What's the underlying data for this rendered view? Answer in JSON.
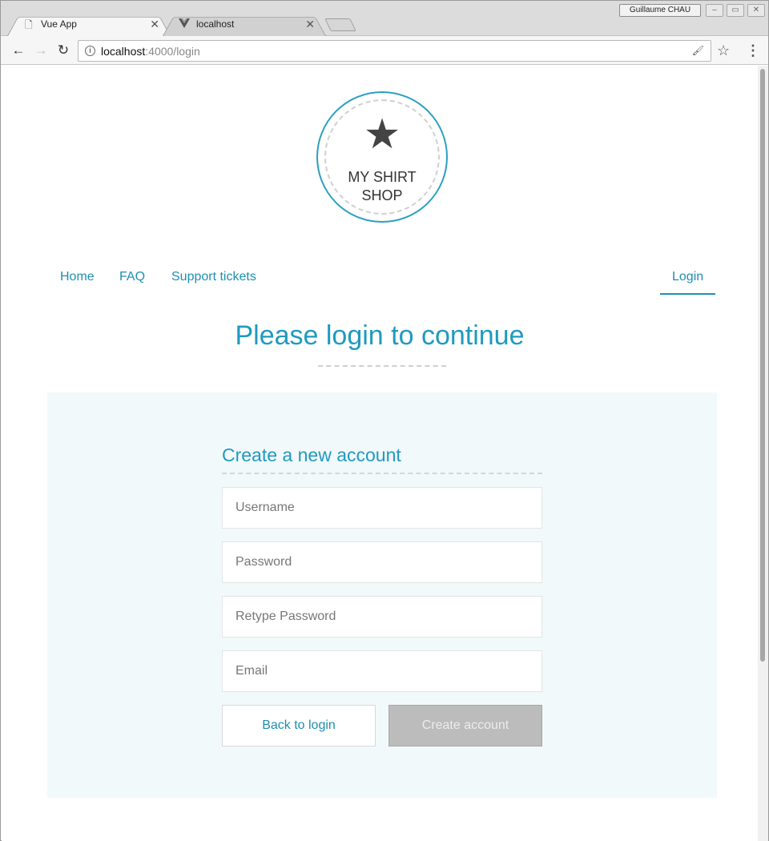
{
  "browser": {
    "profile_name": "Guillaume CHAU",
    "tabs": [
      {
        "title": "Vue App",
        "icon": "document-icon",
        "close": "✕"
      },
      {
        "title": "localhost",
        "icon": "vue-logo-icon",
        "close": "✕"
      }
    ],
    "url_host": "localhost",
    "url_rest": ":4000/login"
  },
  "logo": {
    "star": "★",
    "line1": "MY SHIRT",
    "line2": "SHOP"
  },
  "nav": {
    "links": [
      "Home",
      "FAQ",
      "Support tickets"
    ],
    "login": "Login"
  },
  "page": {
    "heading": "Please login to continue"
  },
  "form": {
    "title": "Create a new account",
    "username_placeholder": "Username",
    "password_placeholder": "Password",
    "retype_placeholder": "Retype Password",
    "email_placeholder": "Email",
    "back_label": "Back to login",
    "create_label": "Create account"
  },
  "colors": {
    "accent": "#1f9abf",
    "panel_bg": "#f2f9fb",
    "disabled_button": "#bcbcbc"
  }
}
